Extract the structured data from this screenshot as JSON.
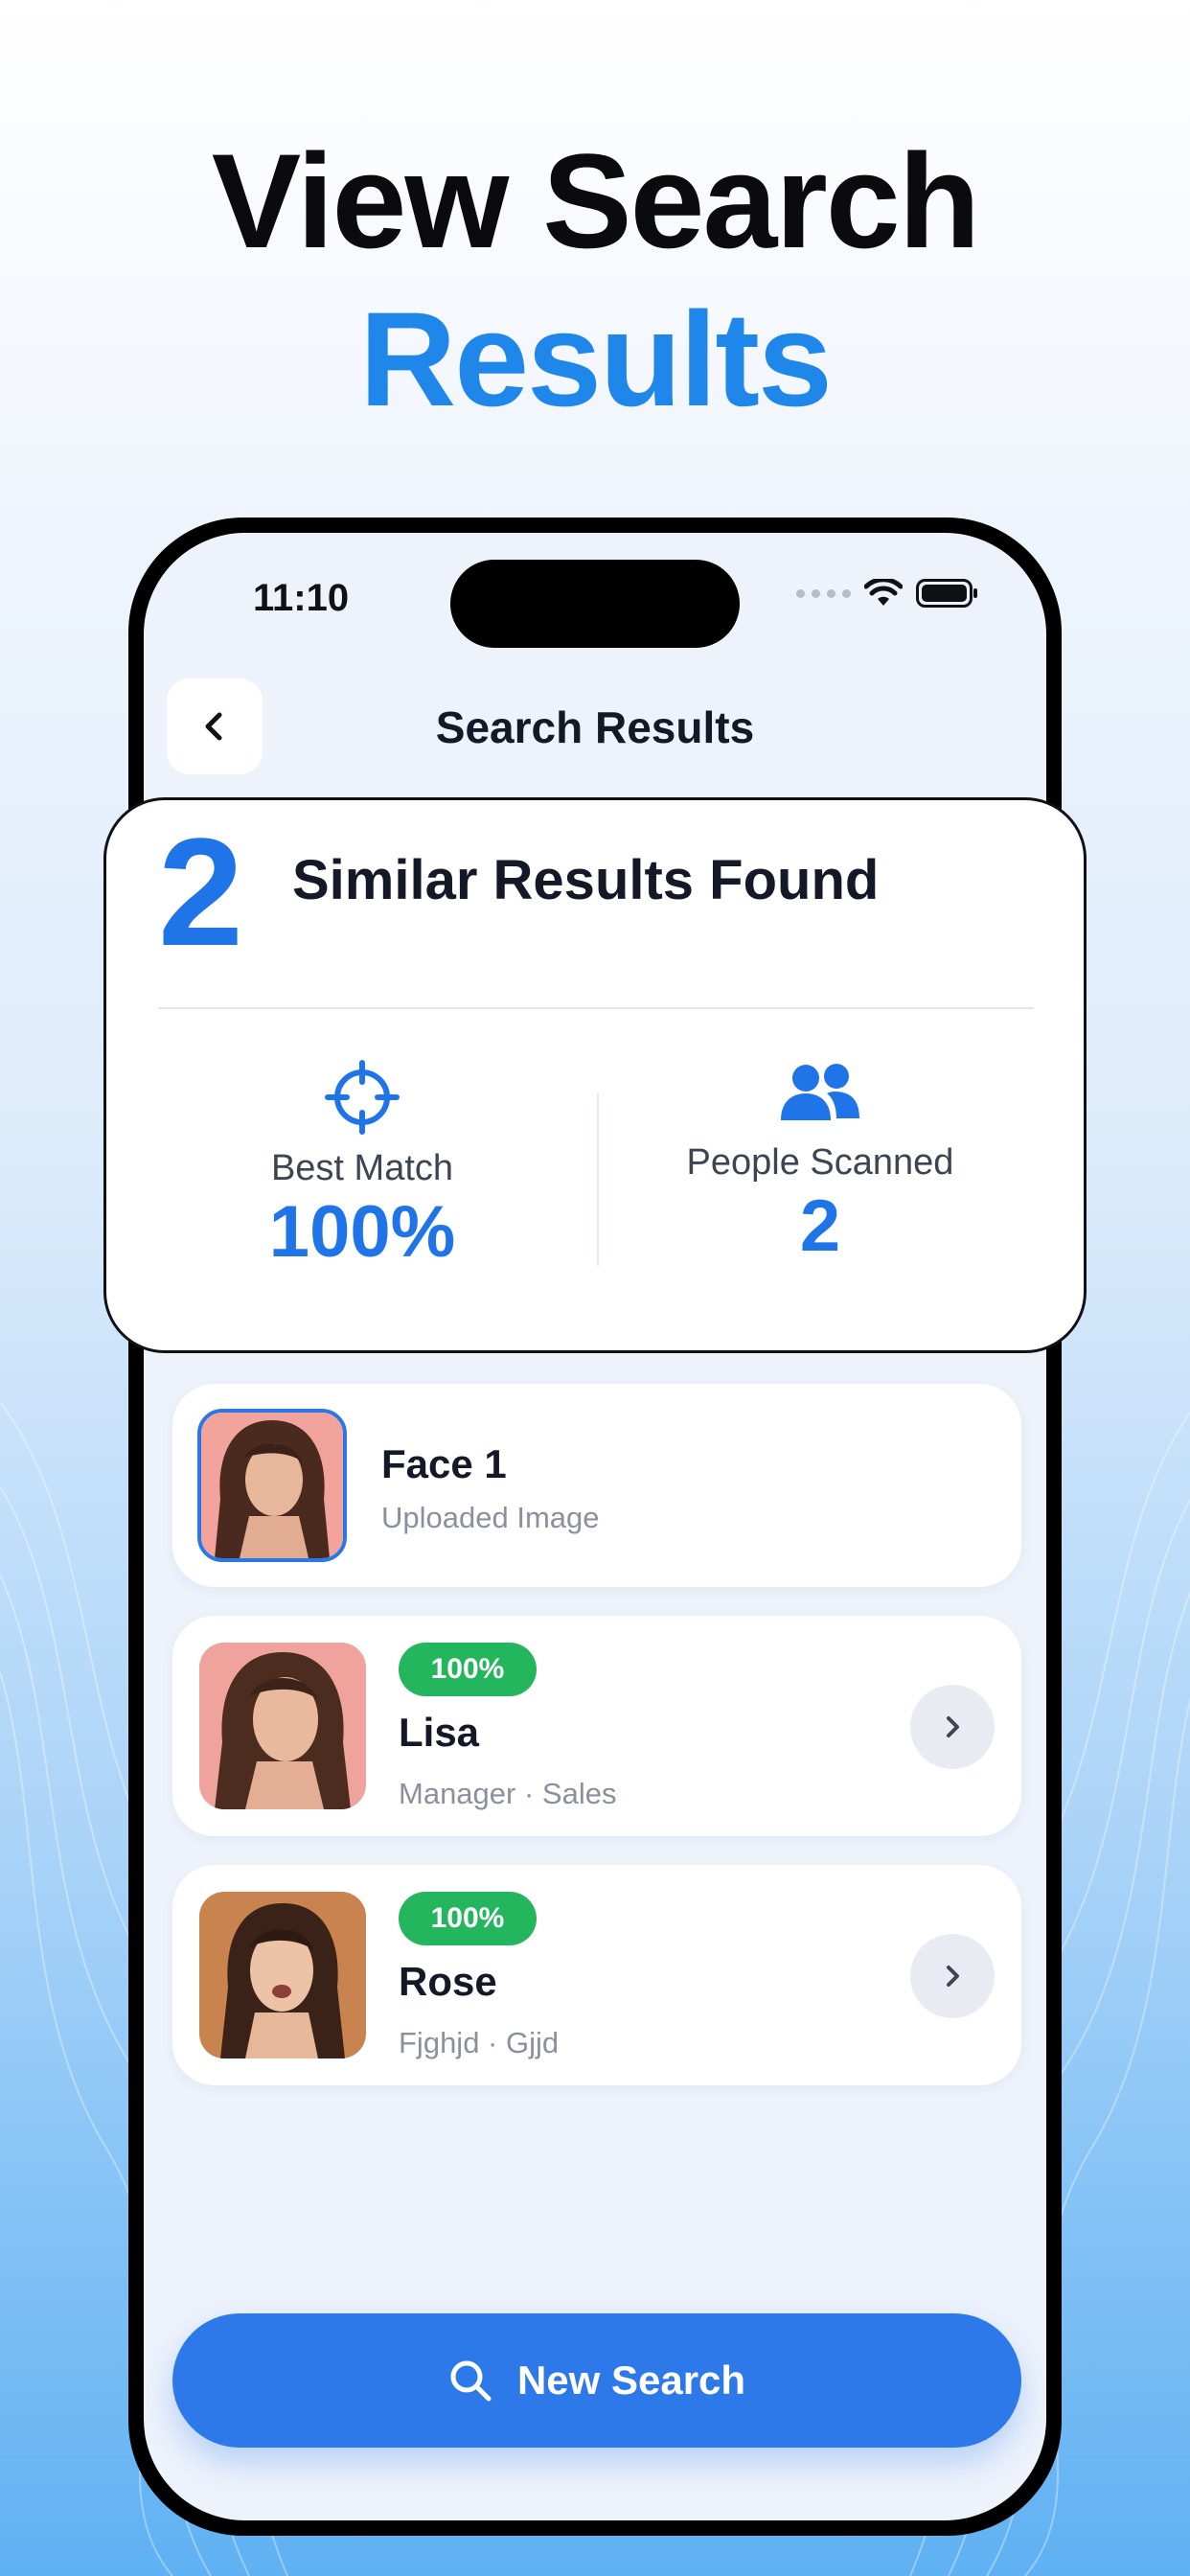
{
  "promo": {
    "headline_line1": "View Search",
    "headline_line2": "Results",
    "accent_color": "#1f87ea"
  },
  "status_bar": {
    "time": "11:10",
    "icons": [
      "signal-dots-icon",
      "wifi-icon",
      "battery-icon"
    ]
  },
  "header": {
    "title": "Search Results",
    "back_icon": "chevron-left-icon"
  },
  "summary": {
    "count": "2",
    "title": "Similar Results Found",
    "stats": [
      {
        "icon": "crosshair-icon",
        "label": "Best Match",
        "value": "100%"
      },
      {
        "icon": "people-icon",
        "label": "People Scanned",
        "value": "2"
      }
    ]
  },
  "uploaded": {
    "name": "Face 1",
    "subtitle": "Uploaded Image"
  },
  "results": [
    {
      "badge": "100%",
      "name": "Lisa",
      "subtitle": "Manager · Sales"
    },
    {
      "badge": "100%",
      "name": "Rose",
      "subtitle": "Fjghjd · Gjjd"
    }
  ],
  "footer": {
    "button_label": "New Search",
    "button_icon": "search-icon",
    "button_color": "#2e79ea"
  }
}
